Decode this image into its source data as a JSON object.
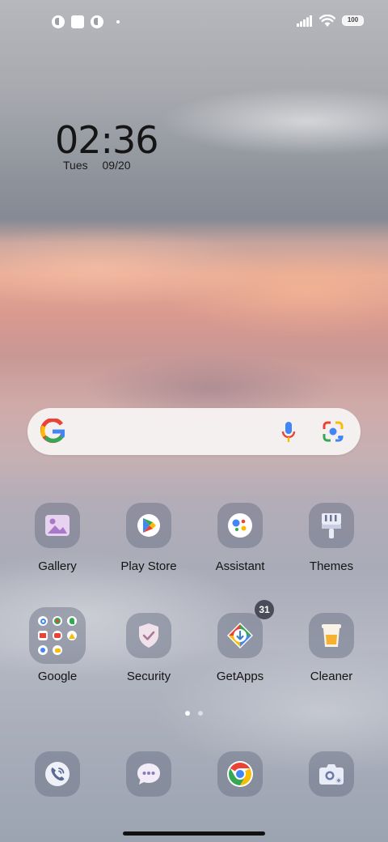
{
  "status_bar": {
    "battery_level": "100",
    "notification_icons": [
      "app-notification-icon",
      "square-notification-icon",
      "app-notification-icon",
      "more-dot-icon"
    ],
    "indicator_icons": [
      "signal-icon",
      "wifi-icon",
      "battery-icon"
    ]
  },
  "clock": {
    "time": "02:36",
    "day": "Tues",
    "date": "09/20"
  },
  "search": {
    "icons": [
      "google-g-icon",
      "microphone-icon",
      "google-lens-icon"
    ]
  },
  "apps": {
    "gallery": {
      "label": "Gallery",
      "icon": "gallery-icon"
    },
    "play_store": {
      "label": "Play Store",
      "icon": "play-store-icon"
    },
    "assistant": {
      "label": "Assistant",
      "icon": "assistant-icon"
    },
    "themes": {
      "label": "Themes",
      "icon": "themes-icon"
    },
    "google": {
      "label": "Google",
      "icon": "folder-icon"
    },
    "security": {
      "label": "Security",
      "icon": "security-icon"
    },
    "getapps": {
      "label": "GetApps",
      "icon": "getapps-icon",
      "badge": "31"
    },
    "cleaner": {
      "label": "Cleaner",
      "icon": "cleaner-icon"
    }
  },
  "page_indicator": {
    "pages": 2,
    "active": 1
  },
  "dock": {
    "items": [
      "phone-icon",
      "messages-icon",
      "chrome-icon",
      "camera-icon"
    ]
  },
  "colors": {
    "google_blue": "#4285F4",
    "google_red": "#EA4335",
    "google_yellow": "#FBBC05",
    "google_green": "#34A853",
    "tile_background": "#5f667d",
    "badge_background": "#4a4d59"
  }
}
